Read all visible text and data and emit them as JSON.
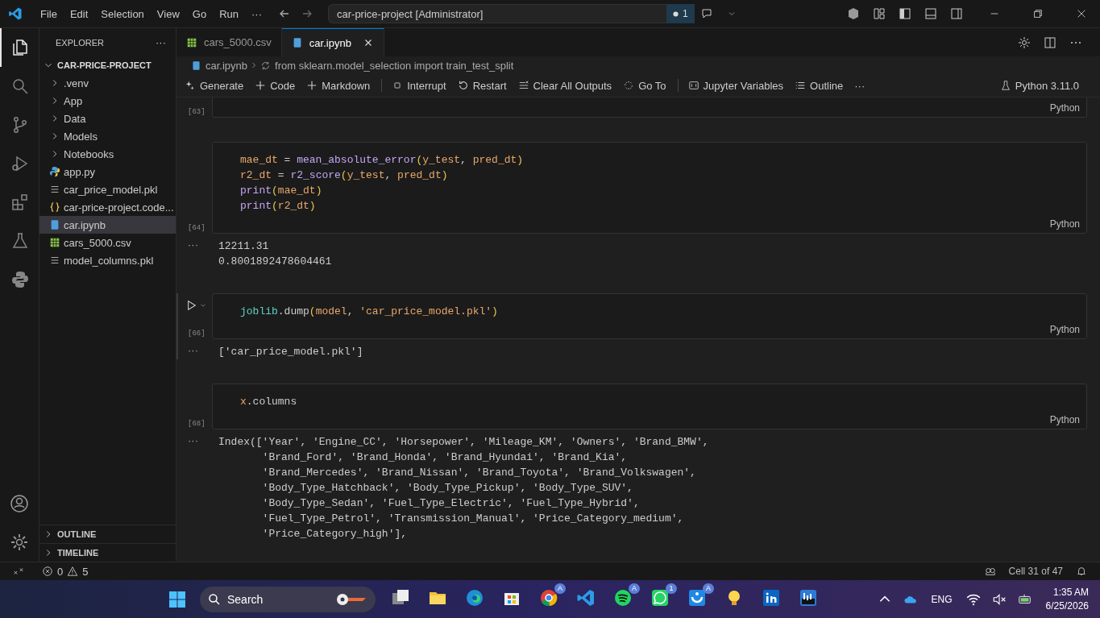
{
  "title_bar": {
    "menus": [
      "File",
      "Edit",
      "Selection",
      "View",
      "Go",
      "Run",
      "···"
    ],
    "command_center": "car-price-project [Administrator]",
    "badge": "1"
  },
  "activity_bar": [
    {
      "kind": "files",
      "selected": true
    },
    {
      "kind": "search",
      "selected": false
    },
    {
      "kind": "source-control",
      "selected": false
    },
    {
      "kind": "run",
      "selected": false
    },
    {
      "kind": "extensions",
      "selected": false
    },
    {
      "kind": "flask",
      "selected": false
    },
    {
      "kind": "python",
      "selected": false
    }
  ],
  "sidebar": {
    "title": "EXPLORER",
    "more": "···",
    "project": {
      "name": "CAR-PRICE-PROJECT",
      "expanded": true,
      "children": [
        {
          "name": ".venv",
          "kind": "folder",
          "selected": false
        },
        {
          "name": "App",
          "kind": "folder",
          "selected": false
        },
        {
          "name": "Data",
          "kind": "folder",
          "selected": false
        },
        {
          "name": "Models",
          "kind": "folder",
          "selected": false
        },
        {
          "name": "Notebooks",
          "kind": "folder",
          "selected": false
        },
        {
          "name": "app.py",
          "kind": "python",
          "selected": false
        },
        {
          "name": "car_price_model.pkl",
          "kind": "file",
          "selected": false
        },
        {
          "name": "car-price-project.code...",
          "kind": "json",
          "selected": false
        },
        {
          "name": "car.ipynb",
          "kind": "notebook",
          "selected": true
        },
        {
          "name": "cars_5000.csv",
          "kind": "csv",
          "selected": false
        },
        {
          "name": "model_columns.pkl",
          "kind": "file",
          "selected": false
        }
      ]
    },
    "sections": [
      "OUTLINE",
      "TIMELINE"
    ]
  },
  "tabs": [
    {
      "label": "cars_5000.csv",
      "kind": "csv",
      "selected": false
    },
    {
      "label": "car.ipynb",
      "kind": "notebook",
      "selected": true
    }
  ],
  "breadcrumb": [
    "car.ipynb",
    "from sklearn.model_selection import train_test_split"
  ],
  "toolbar": [
    {
      "label": "Generate",
      "kind": "sparkle"
    },
    {
      "label": "Code",
      "kind": "plus"
    },
    {
      "label": "Markdown",
      "kind": "plus"
    },
    {
      "label": "Interrupt",
      "kind": "stop",
      "divider": true
    },
    {
      "label": "Restart",
      "kind": "restart"
    },
    {
      "label": "Clear All Outputs",
      "kind": "clear"
    },
    {
      "label": "Go To",
      "kind": "goto"
    },
    {
      "label": "Jupyter Variables",
      "kind": "variables",
      "divider": true
    },
    {
      "label": "Outline",
      "kind": "list"
    },
    {
      "label": "···",
      "kind": "text"
    }
  ],
  "kernel": "Python 3.11.0",
  "cells": [
    {
      "count": "[63]",
      "language": "Python",
      "focused": false
    },
    {
      "count": "[64]",
      "language": "Python",
      "focused": false,
      "lines": [
        [
          {
            "text": "mae_dt",
            "kind": "var"
          },
          {
            "text": " = ",
            "kind": "plain"
          },
          {
            "text": "mean_absolute_error",
            "kind": "fn"
          },
          {
            "text": "(",
            "kind": "paren"
          },
          {
            "text": "y_test",
            "kind": "var"
          },
          {
            "text": ", ",
            "kind": "plain"
          },
          {
            "text": "pred_dt",
            "kind": "var"
          },
          {
            "text": ")",
            "kind": "paren"
          }
        ],
        [
          {
            "text": "r2_dt",
            "kind": "var"
          },
          {
            "text": " = ",
            "kind": "plain"
          },
          {
            "text": "r2_score",
            "kind": "fn"
          },
          {
            "text": "(",
            "kind": "paren"
          },
          {
            "text": "y_test",
            "kind": "var"
          },
          {
            "text": ", ",
            "kind": "plain"
          },
          {
            "text": "pred_dt",
            "kind": "var"
          },
          {
            "text": ")",
            "kind": "paren"
          }
        ],
        [
          {
            "text": "print",
            "kind": "fn"
          },
          {
            "text": "(",
            "kind": "paren"
          },
          {
            "text": "mae_dt",
            "kind": "var"
          },
          {
            "text": ")",
            "kind": "paren"
          }
        ],
        [
          {
            "text": "print",
            "kind": "fn"
          },
          {
            "text": "(",
            "kind": "paren"
          },
          {
            "text": "r2_dt",
            "kind": "var"
          },
          {
            "text": ")",
            "kind": "paren"
          }
        ]
      ],
      "output_menu": "···",
      "output": [
        "12211.31",
        "0.8001892478604461"
      ]
    },
    {
      "count": "[66]",
      "language": "Python",
      "focused": true,
      "lines": [
        [
          {
            "text": "joblib",
            "kind": "module"
          },
          {
            "text": ".dump",
            "kind": "plain"
          },
          {
            "text": "(",
            "kind": "paren"
          },
          {
            "text": "model",
            "kind": "var"
          },
          {
            "text": ", ",
            "kind": "plain"
          },
          {
            "text": "'car_price_model.pkl'",
            "kind": "string"
          },
          {
            "text": ")",
            "kind": "paren"
          }
        ]
      ],
      "output_menu": "···",
      "output": [
        "['car_price_model.pkl']"
      ]
    },
    {
      "count": "[68]",
      "language": "Python",
      "focused": false,
      "lines": [
        [
          {
            "text": "x",
            "kind": "var"
          },
          {
            "text": ".columns",
            "kind": "plain"
          }
        ]
      ],
      "output_menu": "···",
      "output": [
        "Index(['Year', 'Engine_CC', 'Horsepower', 'Mileage_KM', 'Owners', 'Brand_BMW',",
        "       'Brand_Ford', 'Brand_Honda', 'Brand_Hyundai', 'Brand_Kia',",
        "       'Brand_Mercedes', 'Brand_Nissan', 'Brand_Toyota', 'Brand_Volkswagen',",
        "       'Body_Type_Hatchback', 'Body_Type_Pickup', 'Body_Type_SUV',",
        "       'Body_Type_Sedan', 'Fuel_Type_Electric', 'Fuel_Type_Hybrid',",
        "       'Fuel_Type_Petrol', 'Transmission_Manual', 'Price_Category_medium',",
        "       'Price_Category_high'],"
      ]
    }
  ],
  "status_bar": {
    "errors": "0",
    "warnings": "5",
    "cell": "Cell 31 of 47"
  },
  "taskbar": {
    "search": "Search",
    "apps": [
      {
        "kind": "taskview"
      },
      {
        "kind": "folder"
      },
      {
        "kind": "edge"
      },
      {
        "kind": "store"
      },
      {
        "kind": "chrome",
        "badge": "A"
      },
      {
        "kind": "vscode"
      },
      {
        "kind": "spotify",
        "badge": "A"
      },
      {
        "kind": "whatsapp",
        "badge": "1"
      },
      {
        "kind": "blueapp",
        "badge": "A"
      },
      {
        "kind": "bulb"
      },
      {
        "kind": "linkedin"
      },
      {
        "kind": "chart"
      }
    ],
    "language": "ENG",
    "time": "1:35 AM",
    "date": "6/25/2026"
  }
}
